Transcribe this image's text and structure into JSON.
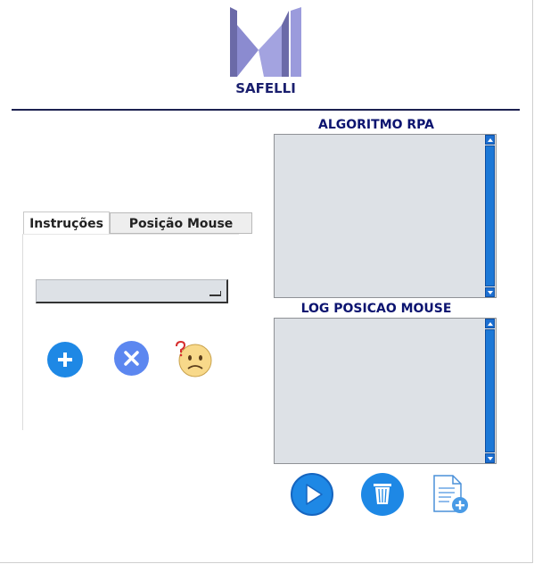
{
  "brand": {
    "name": "SAFELLI"
  },
  "tabs": [
    {
      "label": "Instruções",
      "active": true
    },
    {
      "label": "Posição Mouse",
      "active": false
    }
  ],
  "instructions_panel": {
    "combo_value": "",
    "buttons": [
      {
        "name": "add-button",
        "icon": "plus-icon"
      },
      {
        "name": "remove-button",
        "icon": "close-icon"
      },
      {
        "name": "help-button",
        "icon": "confused-face-question-icon"
      }
    ]
  },
  "sections": {
    "algoritmo_title": "ALGORITMO RPA",
    "algoritmo_text": "",
    "log_title": "LOG POSICAO MOUSE",
    "log_text": ""
  },
  "bottom_buttons": [
    {
      "name": "play-button",
      "icon": "play-icon"
    },
    {
      "name": "delete-button",
      "icon": "trash-icon"
    },
    {
      "name": "new-document-button",
      "icon": "new-document-icon"
    }
  ],
  "colors": {
    "accent_blue": "#1e88e5",
    "title_navy": "#0c1470",
    "field_gray": "#dde1e6"
  }
}
